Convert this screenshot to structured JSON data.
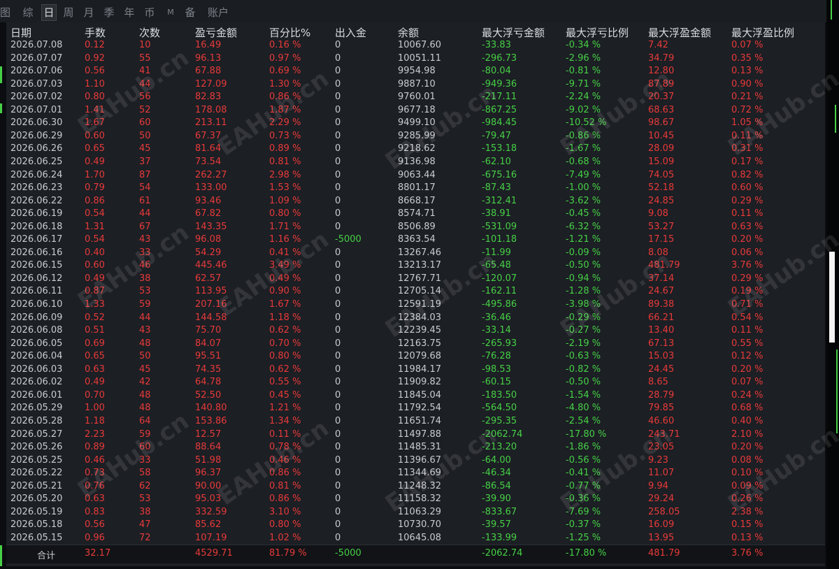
{
  "tabs": [
    {
      "label": "综",
      "active": false
    },
    {
      "label": "日",
      "active": true
    },
    {
      "label": "周",
      "active": false
    },
    {
      "label": "月",
      "active": false
    },
    {
      "label": "季",
      "active": false
    },
    {
      "label": "年",
      "active": false
    },
    {
      "label": "币",
      "active": false
    },
    {
      "label": "M",
      "active": false
    },
    {
      "label": "备",
      "active": false
    },
    {
      "label": "账户",
      "active": false
    }
  ],
  "left_cutoff_label": "图",
  "columns": [
    "日期",
    "手数",
    "次数",
    "盈亏金额",
    "百分比%",
    "出入金",
    "余额",
    "最大浮亏金额",
    "最大浮亏比例",
    "最大浮盈金额",
    "最大浮盈比例"
  ],
  "rows": [
    [
      "2026.07.08",
      "0.12",
      "10",
      "16.49",
      "0.16 %",
      "0",
      "10067.60",
      "-33.83",
      "-0.34 %",
      "7.42",
      "0.07 %"
    ],
    [
      "2026.07.07",
      "0.92",
      "55",
      "96.13",
      "0.97 %",
      "0",
      "10051.11",
      "-296.73",
      "-2.96 %",
      "34.79",
      "0.35 %"
    ],
    [
      "2026.07.06",
      "0.56",
      "41",
      "67.88",
      "0.69 %",
      "0",
      "9954.98",
      "-80.04",
      "-0.81 %",
      "12.80",
      "0.13 %"
    ],
    [
      "2026.07.03",
      "1.10",
      "44",
      "127.09",
      "1.30 %",
      "0",
      "9887.10",
      "-949.36",
      "-9.71 %",
      "87.89",
      "0.90 %"
    ],
    [
      "2026.07.02",
      "0.80",
      "56",
      "82.83",
      "0.86 %",
      "0",
      "9760.01",
      "-217.11",
      "-2.24 %",
      "20.37",
      "0.21 %"
    ],
    [
      "2026.07.01",
      "1.41",
      "52",
      "178.08",
      "1.87 %",
      "0",
      "9677.18",
      "-867.25",
      "-9.02 %",
      "68.63",
      "0.72 %"
    ],
    [
      "2026.06.30",
      "1.67",
      "60",
      "213.11",
      "2.29 %",
      "0",
      "9499.10",
      "-984.45",
      "-10.52 %",
      "98.67",
      "1.05 %"
    ],
    [
      "2026.06.29",
      "0.60",
      "50",
      "67.37",
      "0.73 %",
      "0",
      "9285.99",
      "-79.47",
      "-0.86 %",
      "10.45",
      "0.11 %"
    ],
    [
      "2026.06.26",
      "0.65",
      "45",
      "81.64",
      "0.89 %",
      "0",
      "9218.62",
      "-153.18",
      "-1.67 %",
      "28.09",
      "0.31 %"
    ],
    [
      "2026.06.25",
      "0.49",
      "37",
      "73.54",
      "0.81 %",
      "0",
      "9136.98",
      "-62.10",
      "-0.68 %",
      "15.09",
      "0.17 %"
    ],
    [
      "2026.06.24",
      "1.70",
      "87",
      "262.27",
      "2.98 %",
      "0",
      "9063.44",
      "-675.16",
      "-7.49 %",
      "74.05",
      "0.82 %"
    ],
    [
      "2026.06.23",
      "0.79",
      "54",
      "133.00",
      "1.53 %",
      "0",
      "8801.17",
      "-87.43",
      "-1.00 %",
      "52.18",
      "0.60 %"
    ],
    [
      "2026.06.22",
      "0.86",
      "61",
      "93.46",
      "1.09 %",
      "0",
      "8668.17",
      "-312.41",
      "-3.62 %",
      "24.85",
      "0.29 %"
    ],
    [
      "2026.06.19",
      "0.54",
      "44",
      "67.82",
      "0.80 %",
      "0",
      "8574.71",
      "-38.91",
      "-0.45 %",
      "9.08",
      "0.11 %"
    ],
    [
      "2026.06.18",
      "1.31",
      "67",
      "143.35",
      "1.71 %",
      "0",
      "8506.89",
      "-531.09",
      "-6.32 %",
      "53.27",
      "0.63 %"
    ],
    [
      "2026.06.17",
      "0.54",
      "43",
      "96.08",
      "1.16 %",
      "-5000",
      "8363.54",
      "-101.18",
      "-1.21 %",
      "17.15",
      "0.20 %"
    ],
    [
      "2026.06.16",
      "0.40",
      "33",
      "54.29",
      "0.41 %",
      "0",
      "13267.46",
      "-11.99",
      "-0.09 %",
      "8.08",
      "0.06 %"
    ],
    [
      "2026.06.15",
      "0.60",
      "46",
      "445.46",
      "3.49 %",
      "0",
      "13213.17",
      "-65.48",
      "-0.50 %",
      "481.79",
      "3.76 %"
    ],
    [
      "2026.06.12",
      "0.49",
      "38",
      "62.57",
      "0.49 %",
      "0",
      "12767.71",
      "-120.07",
      "-0.94 %",
      "37.14",
      "0.29 %"
    ],
    [
      "2026.06.11",
      "0.87",
      "53",
      "113.95",
      "0.90 %",
      "0",
      "12705.14",
      "-162.11",
      "-1.28 %",
      "24.67",
      "0.19 %"
    ],
    [
      "2026.06.10",
      "1.33",
      "59",
      "207.16",
      "1.67 %",
      "0",
      "12591.19",
      "-495.86",
      "-3.98 %",
      "89.38",
      "0.71 %"
    ],
    [
      "2026.06.09",
      "0.52",
      "44",
      "144.58",
      "1.18 %",
      "0",
      "12384.03",
      "-36.46",
      "-0.29 %",
      "66.21",
      "0.54 %"
    ],
    [
      "2026.06.08",
      "0.51",
      "43",
      "75.70",
      "0.62 %",
      "0",
      "12239.45",
      "-33.14",
      "-0.27 %",
      "13.40",
      "0.11 %"
    ],
    [
      "2026.06.05",
      "0.69",
      "48",
      "84.07",
      "0.70 %",
      "0",
      "12163.75",
      "-265.93",
      "-2.19 %",
      "67.13",
      "0.55 %"
    ],
    [
      "2026.06.04",
      "0.65",
      "50",
      "95.51",
      "0.80 %",
      "0",
      "12079.68",
      "-76.28",
      "-0.63 %",
      "15.03",
      "0.12 %"
    ],
    [
      "2026.06.03",
      "0.63",
      "45",
      "74.35",
      "0.62 %",
      "0",
      "11984.17",
      "-98.53",
      "-0.82 %",
      "24.45",
      "0.20 %"
    ],
    [
      "2026.06.02",
      "0.49",
      "42",
      "64.78",
      "0.55 %",
      "0",
      "11909.82",
      "-60.15",
      "-0.50 %",
      "8.65",
      "0.07 %"
    ],
    [
      "2026.06.01",
      "0.70",
      "48",
      "52.50",
      "0.45 %",
      "0",
      "11845.04",
      "-183.50",
      "-1.54 %",
      "28.79",
      "0.24 %"
    ],
    [
      "2026.05.29",
      "1.00",
      "48",
      "140.80",
      "1.21 %",
      "0",
      "11792.54",
      "-564.50",
      "-4.80 %",
      "79.85",
      "0.68 %"
    ],
    [
      "2026.05.28",
      "1.18",
      "64",
      "153.86",
      "1.34 %",
      "0",
      "11651.74",
      "-295.35",
      "-2.54 %",
      "46.60",
      "0.40 %"
    ],
    [
      "2026.05.27",
      "2.23",
      "59",
      "12.57",
      "0.11 %",
      "0",
      "11497.88",
      "-2062.74",
      "-17.80 %",
      "243.71",
      "2.10 %"
    ],
    [
      "2026.05.26",
      "0.89",
      "60",
      "88.64",
      "0.78 %",
      "0",
      "11485.31",
      "-213.20",
      "-1.86 %",
      "23.05",
      "0.20 %"
    ],
    [
      "2026.05.25",
      "0.46",
      "33",
      "51.98",
      "0.46 %",
      "0",
      "11396.67",
      "-64.00",
      "-0.56 %",
      "9.23",
      "0.08 %"
    ],
    [
      "2026.05.22",
      "0.73",
      "58",
      "96.37",
      "0.86 %",
      "0",
      "11344.69",
      "-46.34",
      "-0.41 %",
      "11.07",
      "0.10 %"
    ],
    [
      "2026.05.21",
      "0.76",
      "62",
      "90.00",
      "0.81 %",
      "0",
      "11248.32",
      "-86.54",
      "-0.77 %",
      "9.94",
      "0.09 %"
    ],
    [
      "2026.05.20",
      "0.63",
      "53",
      "95.03",
      "0.86 %",
      "0",
      "11158.32",
      "-39.90",
      "-0.36 %",
      "29.24",
      "0.26 %"
    ],
    [
      "2026.05.19",
      "0.83",
      "38",
      "332.59",
      "3.10 %",
      "0",
      "11063.29",
      "-833.67",
      "-7.69 %",
      "258.05",
      "2.38 %"
    ],
    [
      "2026.05.18",
      "0.56",
      "47",
      "85.62",
      "0.80 %",
      "0",
      "10730.70",
      "-39.57",
      "-0.37 %",
      "16.09",
      "0.15 %"
    ],
    [
      "2026.05.15",
      "0.96",
      "72",
      "107.19",
      "1.02 %",
      "0",
      "10645.08",
      "-133.99",
      "-1.25 %",
      "13.95",
      "0.13 %"
    ]
  ],
  "totals": {
    "label": "合计",
    "lots": "32.17",
    "profit": "4529.71",
    "percent": "81.79 %",
    "deposit": "-5000",
    "max_float_loss": "-2062.74",
    "max_float_loss_pct": "-17.80 %",
    "max_float_profit": "481.79",
    "max_float_profit_pct": "3.76 %"
  },
  "watermark": "EAHub.cn",
  "colors": {
    "profit": "#e83a3a",
    "loss": "#46d046",
    "neutral": "#c9ccd0",
    "header": "#d9dce0"
  }
}
